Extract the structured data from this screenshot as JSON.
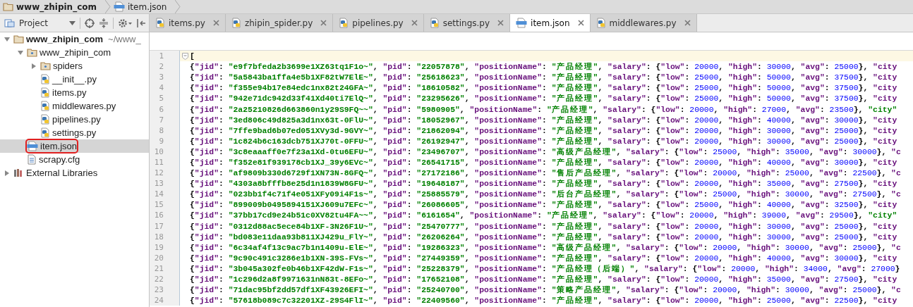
{
  "breadcrumb": [
    {
      "label": "www_zhipin_com",
      "kind": "folder"
    },
    {
      "label": "item.json",
      "kind": "json"
    }
  ],
  "project_panel": {
    "label": "Project"
  },
  "tabs": [
    {
      "label": "items.py",
      "kind": "python",
      "selected": false
    },
    {
      "label": "zhipin_spider.py",
      "kind": "python",
      "selected": false
    },
    {
      "label": "pipelines.py",
      "kind": "python",
      "selected": false
    },
    {
      "label": "settings.py",
      "kind": "python",
      "selected": false
    },
    {
      "label": "item.json",
      "kind": "json",
      "selected": true
    },
    {
      "label": "middlewares.py",
      "kind": "python",
      "selected": false
    }
  ],
  "tree": [
    {
      "label": "www_zhipin_com",
      "suffix": "~/www_",
      "kind": "folder",
      "expanded": true,
      "selected": false,
      "outlined": false,
      "children": [
        {
          "label": "www_zhipin_com",
          "kind": "package",
          "expanded": true,
          "selected": false,
          "outlined": false,
          "children": [
            {
              "label": "spiders",
              "kind": "package",
              "expanded": false,
              "selected": false,
              "outlined": false
            },
            {
              "label": "__init__.py",
              "kind": "python",
              "selected": false,
              "outlined": false
            },
            {
              "label": "items.py",
              "kind": "python",
              "selected": false,
              "outlined": false
            },
            {
              "label": "middlewares.py",
              "kind": "python",
              "selected": false,
              "outlined": false
            },
            {
              "label": "pipelines.py",
              "kind": "python",
              "selected": false,
              "outlined": false
            },
            {
              "label": "settings.py",
              "kind": "python",
              "selected": false,
              "outlined": false
            }
          ]
        },
        {
          "label": "item.json",
          "kind": "json",
          "selected": true,
          "outlined": true
        },
        {
          "label": "scrapy.cfg",
          "kind": "config",
          "selected": false,
          "outlined": false
        }
      ]
    },
    {
      "label": "External Libraries",
      "kind": "library",
      "expanded": false,
      "selected": false,
      "outlined": false
    }
  ],
  "editor": {
    "lines": [
      {
        "number": "1",
        "current": true,
        "text": "["
      },
      {
        "number": "2",
        "current": false,
        "text": "{\"jid\": \"e9f7bfeda2b3699e1XZ63tq1F1o~\", \"pid\": \"22057878\", \"positionName\": \"产品经理\", \"salary\": {\"low\": 20000, \"high\": 30000, \"avg\": 25000}, \"city"
      },
      {
        "number": "3",
        "current": false,
        "text": "{\"jid\": \"5a5843ba1ffa4e5b1XF82tW7ElE~\", \"pid\": \"25618623\", \"positionName\": \"产品经理\", \"salary\": {\"low\": 25000, \"high\": 50000, \"avg\": 37500}, \"city"
      },
      {
        "number": "4",
        "current": false,
        "text": "{\"jid\": \"f355e94b17e84edc1nx82t24GFA~\", \"pid\": \"18610582\", \"positionName\": \"产品经理\", \"salary\": {\"low\": 25000, \"high\": 50000, \"avg\": 37500}, \"city"
      },
      {
        "number": "5",
        "current": false,
        "text": "{\"jid\": \"942e71dc942d33f41Xd40ti7ElQ~\", \"pid\": \"23295626\", \"positionName\": \"产品经理\", \"salary\": {\"low\": 25000, \"high\": 50000, \"avg\": 37500}, \"city"
      },
      {
        "number": "6",
        "current": false,
        "text": "{\"jid\": \"2a25210826d663860n1y29S9FQ~~\", \"pid\": \"5980905\", \"positionName\": \"产品经理\", \"salary\": {\"low\": 20000, \"high\": 27000, \"avg\": 23500}, \"city\""
      },
      {
        "number": "7",
        "current": false,
        "text": "{\"jid\": \"3ed806c49d825a3d1nx63t-0FlU~\", \"pid\": \"18052967\", \"positionName\": \"产品经理\", \"salary\": {\"low\": 20000, \"high\": 40000, \"avg\": 30000}, \"city"
      },
      {
        "number": "8",
        "current": false,
        "text": "{\"jid\": \"7ffe9bad6b07ed051XVy3d-9GVY~\", \"pid\": \"21862094\", \"positionName\": \"产品经理\", \"salary\": {\"low\": 20000, \"high\": 30000, \"avg\": 25000}, \"city"
      },
      {
        "number": "9",
        "current": false,
        "text": "{\"jid\": \"1c824b6c163dcb751XJ70t-0FFU~\", \"pid\": \"26192947\", \"positionName\": \"产品经理\", \"salary\": {\"low\": 20000, \"high\": 30000, \"avg\": 25000}, \"city"
      },
      {
        "number": "10",
        "current": false,
        "text": "{\"jid\": \"3c8eaaaff0e7f23a1Xd-0tu6EFU~\", \"pid\": \"23496707\", \"positionName\": \"高级产品经理\", \"salary\": {\"low\": 25000, \"high\": 35000, \"avg\": 30000}, \"c"
      },
      {
        "number": "11",
        "current": false,
        "text": "{\"jid\": \"f352e81f939178cb1XJ_39y6EVc~\", \"pid\": \"26541715\", \"positionName\": \"产品经理\", \"salary\": {\"low\": 20000, \"high\": 40000, \"avg\": 30000}, \"city"
      },
      {
        "number": "12",
        "current": false,
        "text": "{\"jid\": \"af9809b330d6729f1XN73N-8GFQ~\", \"pid\": \"27172186\", \"positionName\": \"售后产品经理\", \"salary\": {\"low\": 20000, \"high\": 25000, \"avg\": 22500}, \"c"
      },
      {
        "number": "13",
        "current": false,
        "text": "{\"jid\": \"4303a8bfffb8e25d1n1839W8GFU~\", \"pid\": \"19648187\", \"positionName\": \"产品经理\", \"salary\": {\"low\": 20000, \"high\": 35000, \"avg\": 27500}, \"city"
      },
      {
        "number": "14",
        "current": false,
        "text": "{\"jid\": \"023bb1f4c71f4e051XFy09i4F1s~\", \"pid\": \"25885579\", \"positionName\": \"后台产品经理\", \"salary\": {\"low\": 25000, \"high\": 30000, \"avg\": 27500}, \"c"
      },
      {
        "number": "15",
        "current": false,
        "text": "{\"jid\": \"899009b0495894151XJ609u7EFc~\", \"pid\": \"26086605\", \"positionName\": \"产品经理\", \"salary\": {\"low\": 25000, \"high\": 40000, \"avg\": 32500}, \"city"
      },
      {
        "number": "16",
        "current": false,
        "text": "{\"jid\": \"37bb17cd9e24b51c0XV82tu4FA~~\", \"pid\": \"6161654\", \"positionName\": \"产品经理\", \"salary\": {\"low\": 20000, \"high\": 39000, \"avg\": 29500}, \"city\""
      },
      {
        "number": "17",
        "current": false,
        "text": "{\"jid\": \"0312d88ac5ece84b1XF-3N26F1U~\", \"pid\": \"25470777\", \"positionName\": \"产品经理\", \"salary\": {\"low\": 20000, \"high\": 30000, \"avg\": 25000}, \"city"
      },
      {
        "number": "18",
        "current": false,
        "text": "{\"jid\": \"bd083e11daa93b811XJ429u_FlY~\", \"pid\": \"26206264\", \"positionName\": \"产品经理\", \"salary\": {\"low\": 20000, \"high\": 30000, \"avg\": 25000}, \"city"
      },
      {
        "number": "19",
        "current": false,
        "text": "{\"jid\": \"6c34af4f13c9ac7b1n1409u-ElE~\", \"pid\": \"19286323\", \"positionName\": \"高级产品经理\", \"salary\": {\"low\": 20000, \"high\": 30000, \"avg\": 25000}, \"c"
      },
      {
        "number": "20",
        "current": false,
        "text": "{\"jid\": \"9c90c491c3286e1b1XN-39S-FVs~\", \"pid\": \"27449359\", \"positionName\": \"产品经理\", \"salary\": {\"low\": 20000, \"high\": 40000, \"avg\": 30000}, \"city"
      },
      {
        "number": "21",
        "current": false,
        "text": "{\"jid\": \"3b045a302fe0b46b1XF42dW-F1s~\", \"pid\": \"25228379\", \"positionName\": \"产品经理（后端）\", \"salary\": {\"low\": 20000, \"high\": 34000, \"avg\": 27000}"
      },
      {
        "number": "22",
        "current": false,
        "text": "{\"jid\": \"1c296d2a8f9971631nN83t-8EFo~\", \"pid\": \"17652108\", \"positionName\": \"产品经理\", \"salary\": {\"low\": 20000, \"high\": 35000, \"avg\": 27500}, \"city"
      },
      {
        "number": "23",
        "current": false,
        "text": "{\"jid\": \"71dac95bf2dd57df1XF43926EFI~\", \"pid\": \"25240700\", \"positionName\": \"策略产品经理\", \"salary\": {\"low\": 20000, \"high\": 30000, \"avg\": 25000}, \"c"
      },
      {
        "number": "24",
        "current": false,
        "text": "{\"jid\": \"57618b089c7c32201XZ-29S4FlI~\", \"pid\": \"22409560\", \"positionName\": \"产品经理\", \"salary\": {\"low\": 20000, \"high\": 25000, \"avg\": 22500}, \"city"
      }
    ]
  }
}
